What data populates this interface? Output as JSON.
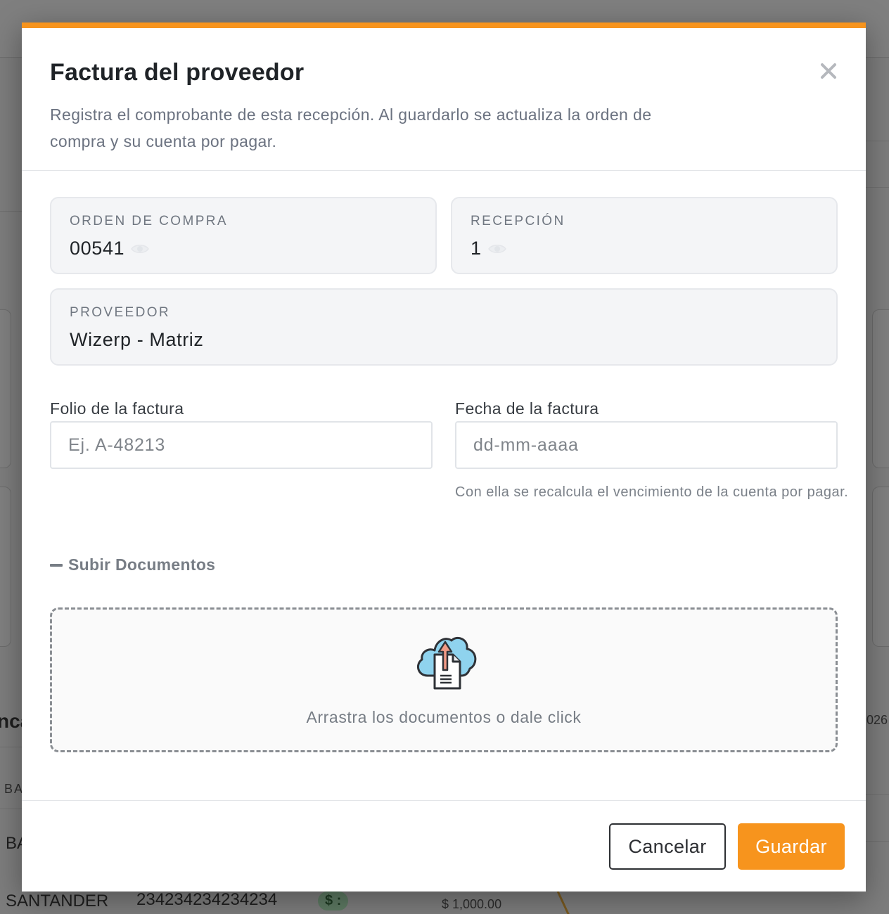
{
  "background": {
    "fragments": {
      "left_partial": "nca",
      "right_partial": "026",
      "col_partial": "BA",
      "row_partial": "BA",
      "bank_name": "SANTANDER",
      "account_number": "234234234234234",
      "badge": "$ :",
      "amount": "$ 1,000.00"
    }
  },
  "modal": {
    "accent_color": "#f7941d",
    "title": "Factura del proveedor",
    "description": "Registra el comprobante de esta recepción. Al guardarlo se actualiza la orden de compra y su cuenta por pagar.",
    "close_icon": "close-icon",
    "purchase_order": {
      "label": "ORDEN DE COMPRA",
      "value": "00541",
      "icon": "eye-icon"
    },
    "reception": {
      "label": "RECEPCIÓN",
      "value": "1",
      "icon": "eye-icon"
    },
    "supplier": {
      "label": "PROVEEDOR",
      "value": "Wizerp - Matriz"
    },
    "invoice_folio": {
      "label": "Folio de la factura",
      "placeholder": "Ej. A-48213",
      "value": ""
    },
    "invoice_date": {
      "label": "Fecha de la factura",
      "placeholder": "dd-mm-aaaa",
      "value": "",
      "hint": "Con ella se recalcula el vencimiento de la cuenta por pagar."
    },
    "upload_section": {
      "toggle_label": "Subir Documentos",
      "toggle_icon": "minus-icon",
      "dropzone_icon": "cloud-upload-icon",
      "dropzone_text": "Arrastra los documentos o dale click"
    },
    "footer": {
      "cancel_label": "Cancelar",
      "save_label": "Guardar"
    }
  }
}
